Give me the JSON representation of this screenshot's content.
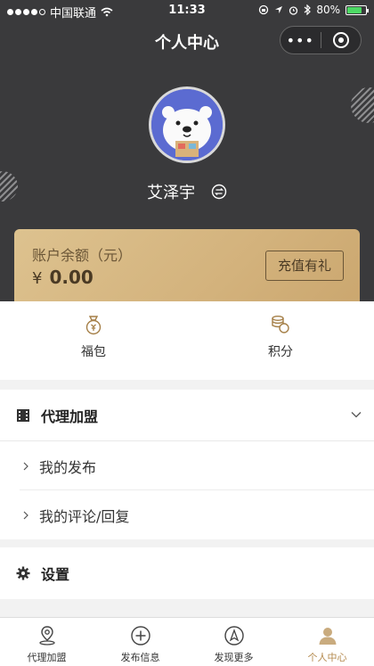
{
  "status_bar": {
    "carrier": "中国联通",
    "time": "11:33",
    "battery": "80%",
    "battery_level": 0.8
  },
  "nav": {
    "title": "个人中心",
    "more_label": "•••"
  },
  "profile": {
    "username": "艾泽宇"
  },
  "balance": {
    "label": "账户余额（元）",
    "currency": "¥",
    "amount": "0.00",
    "recharge_label": "充值有礼"
  },
  "quick": [
    {
      "label": "福包",
      "icon": "coin-bag-icon"
    },
    {
      "label": "积分",
      "icon": "coin-stack-icon"
    }
  ],
  "menu": {
    "agency": {
      "title": "代理加盟",
      "icon": "film-icon",
      "children": [
        {
          "label": "我的发布"
        },
        {
          "label": "我的评论/回复"
        }
      ]
    },
    "settings": {
      "title": "设置",
      "icon": "gear-icon"
    }
  },
  "tabbar": [
    {
      "label": "代理加盟",
      "icon": "location-pin-icon",
      "active": false
    },
    {
      "label": "发布信息",
      "icon": "plus-circle-icon",
      "active": false
    },
    {
      "label": "发现更多",
      "icon": "compass-icon",
      "active": false
    },
    {
      "label": "个人中心",
      "icon": "person-icon",
      "active": true
    }
  ],
  "colors": {
    "header_bg": "#3a3a3c",
    "gold_card": "#d8b985",
    "active_tab": "#b48a4e"
  }
}
